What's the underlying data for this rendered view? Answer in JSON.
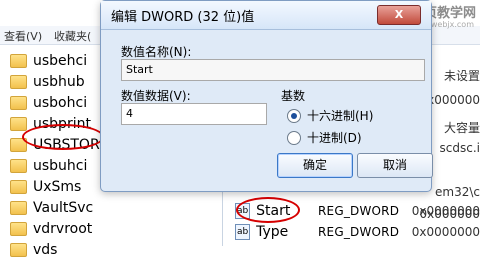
{
  "menubar": {
    "items": [
      "查看(V)",
      "收藏夹("
    ]
  },
  "tree": {
    "items": [
      {
        "label": "usbehci"
      },
      {
        "label": "usbhub"
      },
      {
        "label": "usbohci"
      },
      {
        "label": "usbprint"
      },
      {
        "label": "USBSTOR"
      },
      {
        "label": "usbuhci"
      },
      {
        "label": "UxSms"
      },
      {
        "label": "VaultSvc"
      },
      {
        "label": "vdrvroot"
      },
      {
        "label": "vds"
      }
    ]
  },
  "dialog": {
    "title": "编辑 DWORD (32 位)值",
    "close_label": "X",
    "value_name_label": "数值名称(N):",
    "value_name": "Start",
    "value_data_label": "数值数据(V):",
    "value_data": "4",
    "base_label": "基数",
    "radio_hex": "十六进制(H)",
    "radio_dec": "十进制(D)",
    "ok_label": "确定",
    "cancel_label": "取消"
  },
  "registry": {
    "partials": [
      "未设置",
      "0x000000",
      "大容量",
      "scdsc.i",
      "em32\\c",
      "0x000000"
    ],
    "values": [
      {
        "name": "Start",
        "type": "REG_DWORD",
        "data": "0x0000000"
      },
      {
        "name": "Type",
        "type": "REG_DWORD",
        "data": "0x0000000"
      }
    ]
  },
  "watermark": {
    "line1": "网页教学网",
    "line2": "www.webjx.com"
  }
}
